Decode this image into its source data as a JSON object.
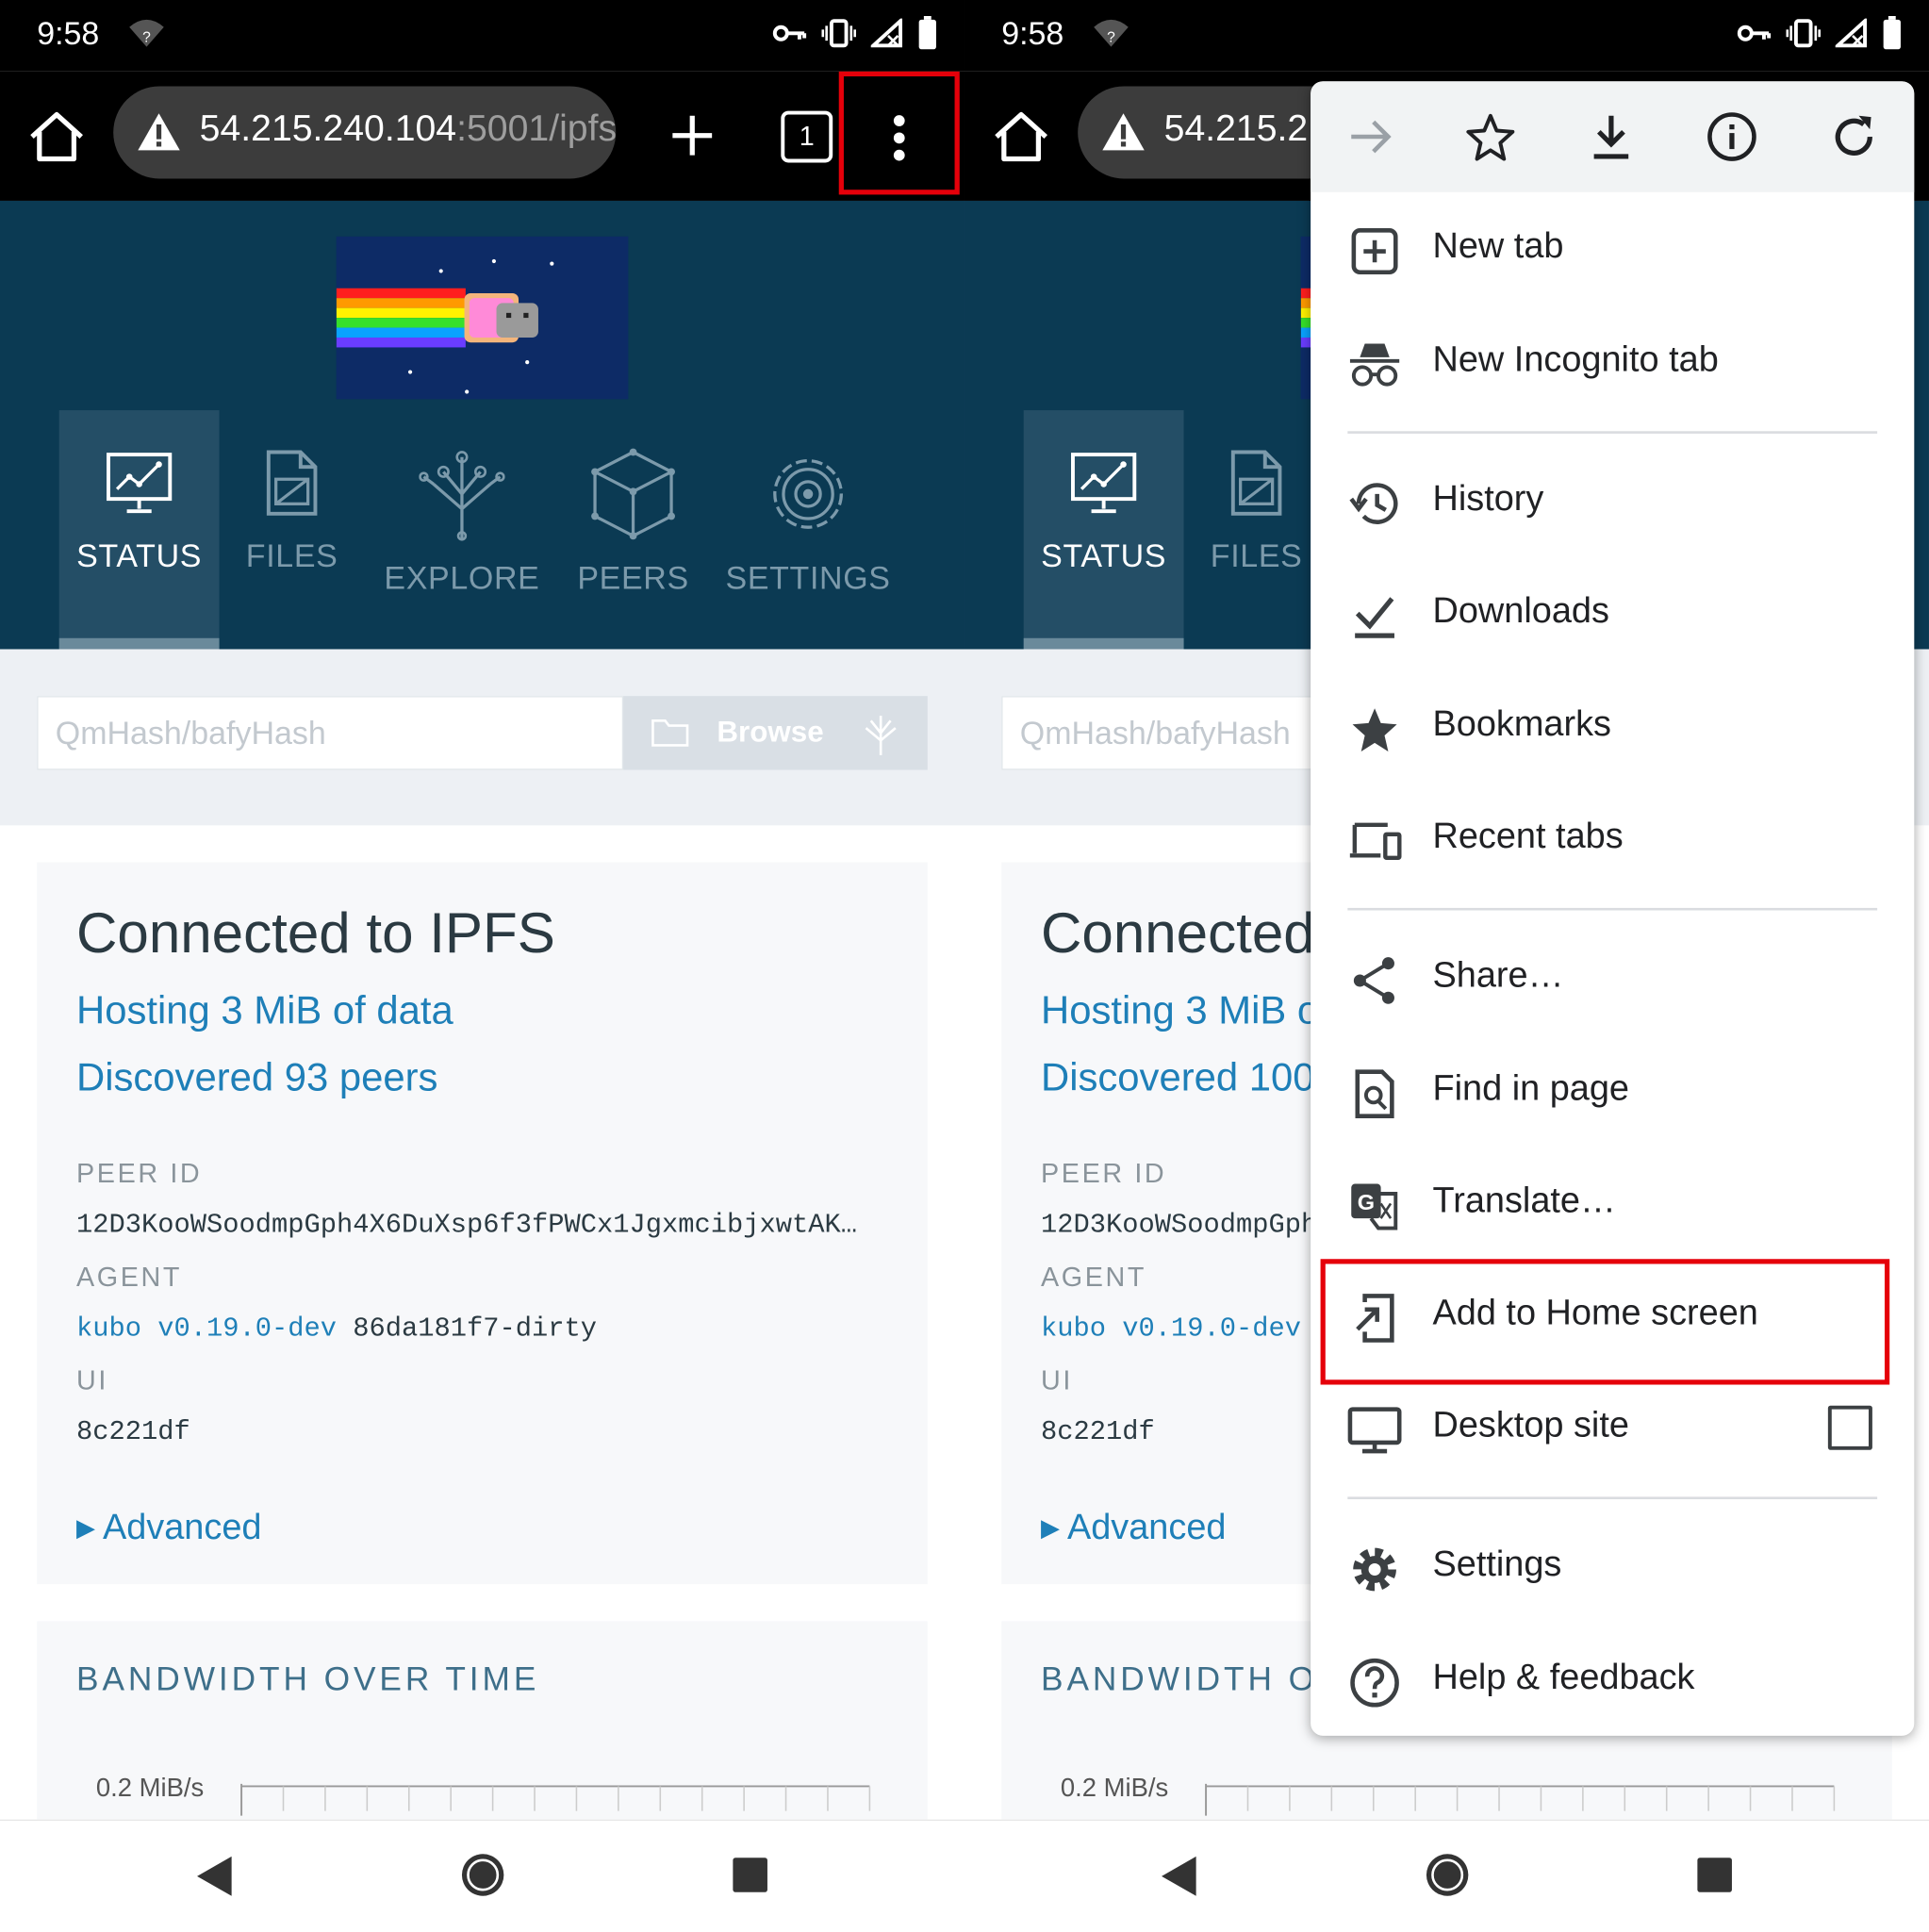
{
  "status_bar": {
    "time": "9:58"
  },
  "toolbar": {
    "url_host": "54.215.240.104",
    "url_rest": ":5001/ipfs",
    "url_host_right": "54.215.2",
    "tab_count": "1"
  },
  "ipfs": {
    "nav": [
      {
        "label": "STATUS"
      },
      {
        "label": "FILES"
      },
      {
        "label": "EXPLORE"
      },
      {
        "label": "PEERS"
      },
      {
        "label": "SETTINGS"
      }
    ],
    "search_placeholder": "QmHash/bafyHash",
    "browse_label": "Browse"
  },
  "status_card": {
    "title": "Connected to IPFS",
    "hosting": "Hosting 3 MiB of data",
    "peers_left": "Discovered 93 peers",
    "peers_right": "Discovered 100",
    "peer_id_label": "PEER ID",
    "peer_id": "12D3KooWSoodmpGph4X6DuXsp6f3fPWCx1JgxmcibjxwtAK…",
    "agent_label": "AGENT",
    "agent_link": "kubo v0.19.0-dev",
    "agent_suffix": "86da181f7-dirty",
    "ui_label": "UI",
    "ui_value": "8c221df",
    "advanced": "Advanced"
  },
  "bandwidth": {
    "title": "BANDWIDTH OVER TIME",
    "tick": "0.2 MiB/s"
  },
  "menu": {
    "top_icons": [
      "forward-icon",
      "star-icon",
      "download-icon",
      "info-icon",
      "refresh-icon"
    ],
    "items": [
      {
        "label": "New tab"
      },
      {
        "label": "New Incognito tab"
      },
      {
        "label": "History"
      },
      {
        "label": "Downloads"
      },
      {
        "label": "Bookmarks"
      },
      {
        "label": "Recent tabs"
      },
      {
        "label": "Share…"
      },
      {
        "label": "Find in page"
      },
      {
        "label": "Translate…"
      },
      {
        "label": "Add to Home screen"
      },
      {
        "label": "Desktop site",
        "checked": false
      },
      {
        "label": "Settings"
      },
      {
        "label": "Help & feedback"
      }
    ]
  },
  "colors": {
    "highlight": "#e5000a",
    "ipfs_header": "#0b3a53",
    "link": "#1e7fb8"
  }
}
